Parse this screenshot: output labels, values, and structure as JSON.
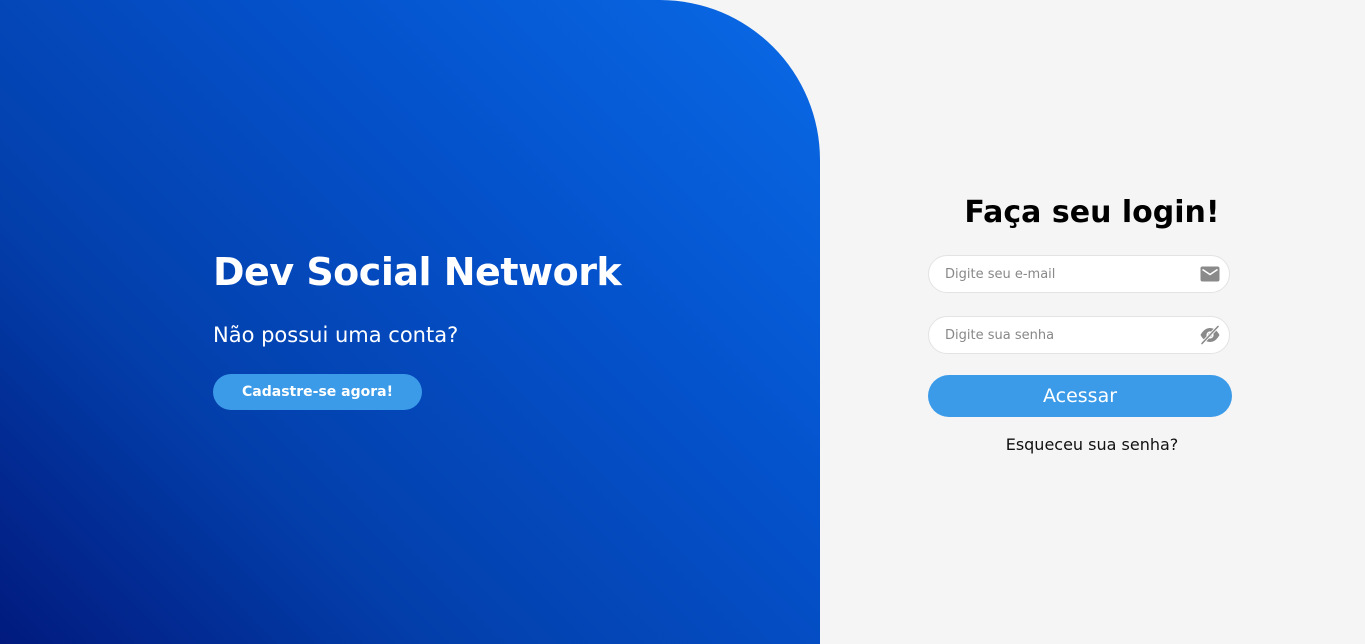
{
  "hero": {
    "title": "Dev Social Network",
    "subtitle": "Não possui uma conta?",
    "signup_label": "Cadastre-se agora!"
  },
  "login": {
    "title": "Faça seu login!",
    "email_placeholder": "Digite seu e-mail",
    "email_icon": "mail-icon",
    "password_placeholder": "Digite sua senha",
    "password_icon": "eye-off-icon",
    "submit_label": "Acessar",
    "forgot_label": "Esqueceu sua senha?"
  },
  "colors": {
    "hero_gradient_start": "#0a6ae6",
    "hero_gradient_end": "#011a7e",
    "accent_button": "#3b9be8",
    "background": "#f5f5f5",
    "icon": "#8a8a8a"
  }
}
